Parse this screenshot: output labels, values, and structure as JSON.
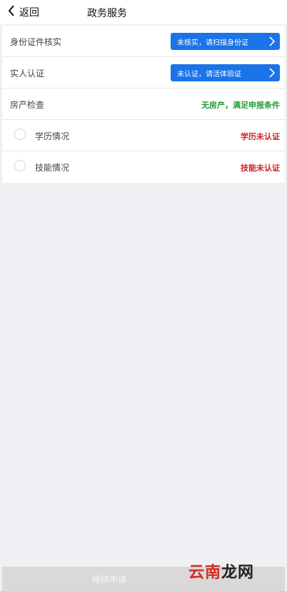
{
  "header": {
    "back_label": "返回",
    "title": "政务服务"
  },
  "rows": [
    {
      "label": "身份证件核实",
      "button": "未核实，请扫描身份证"
    },
    {
      "label": "实人认证",
      "button": "未认证，请活体验证"
    },
    {
      "label": "房产检查",
      "status": "无房产，满足申报条件"
    },
    {
      "label": "学历情况",
      "status": "学历未认证"
    },
    {
      "label": "技能情况",
      "status": "技能未认证"
    }
  ],
  "footer": {
    "submit_label": "继续申请"
  },
  "watermark": {
    "text_red": "云南",
    "text_dark": "龙网"
  },
  "colors": {
    "accent_blue": "#1a73e8",
    "ok_green": "#1f9c3a",
    "warn_red": "#d0232b",
    "page_bg": "#eff0f4"
  },
  "icons": {
    "back": "chevron-left-icon",
    "button_arrow": "chevron-right-icon"
  }
}
